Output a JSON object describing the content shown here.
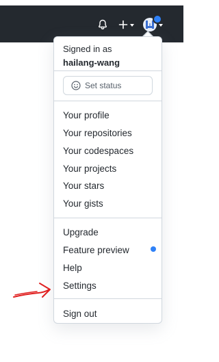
{
  "header": {
    "notifications_icon": "bell-icon",
    "create_icon": "plus-icon",
    "avatar_icon": "user-avatar"
  },
  "menu": {
    "signed_in_label": "Signed in as",
    "username": "hailang-wang",
    "set_status": "Set status",
    "profile_items": [
      "Your profile",
      "Your repositories",
      "Your codespaces",
      "Your projects",
      "Your stars",
      "Your gists"
    ],
    "settings_items": [
      "Upgrade",
      "Feature preview",
      "Help",
      "Settings"
    ],
    "sign_out": "Sign out"
  },
  "colors": {
    "header_bg": "#24292f",
    "notice_dot": "#2f81f7",
    "annotation_arrow": "#e02020"
  }
}
